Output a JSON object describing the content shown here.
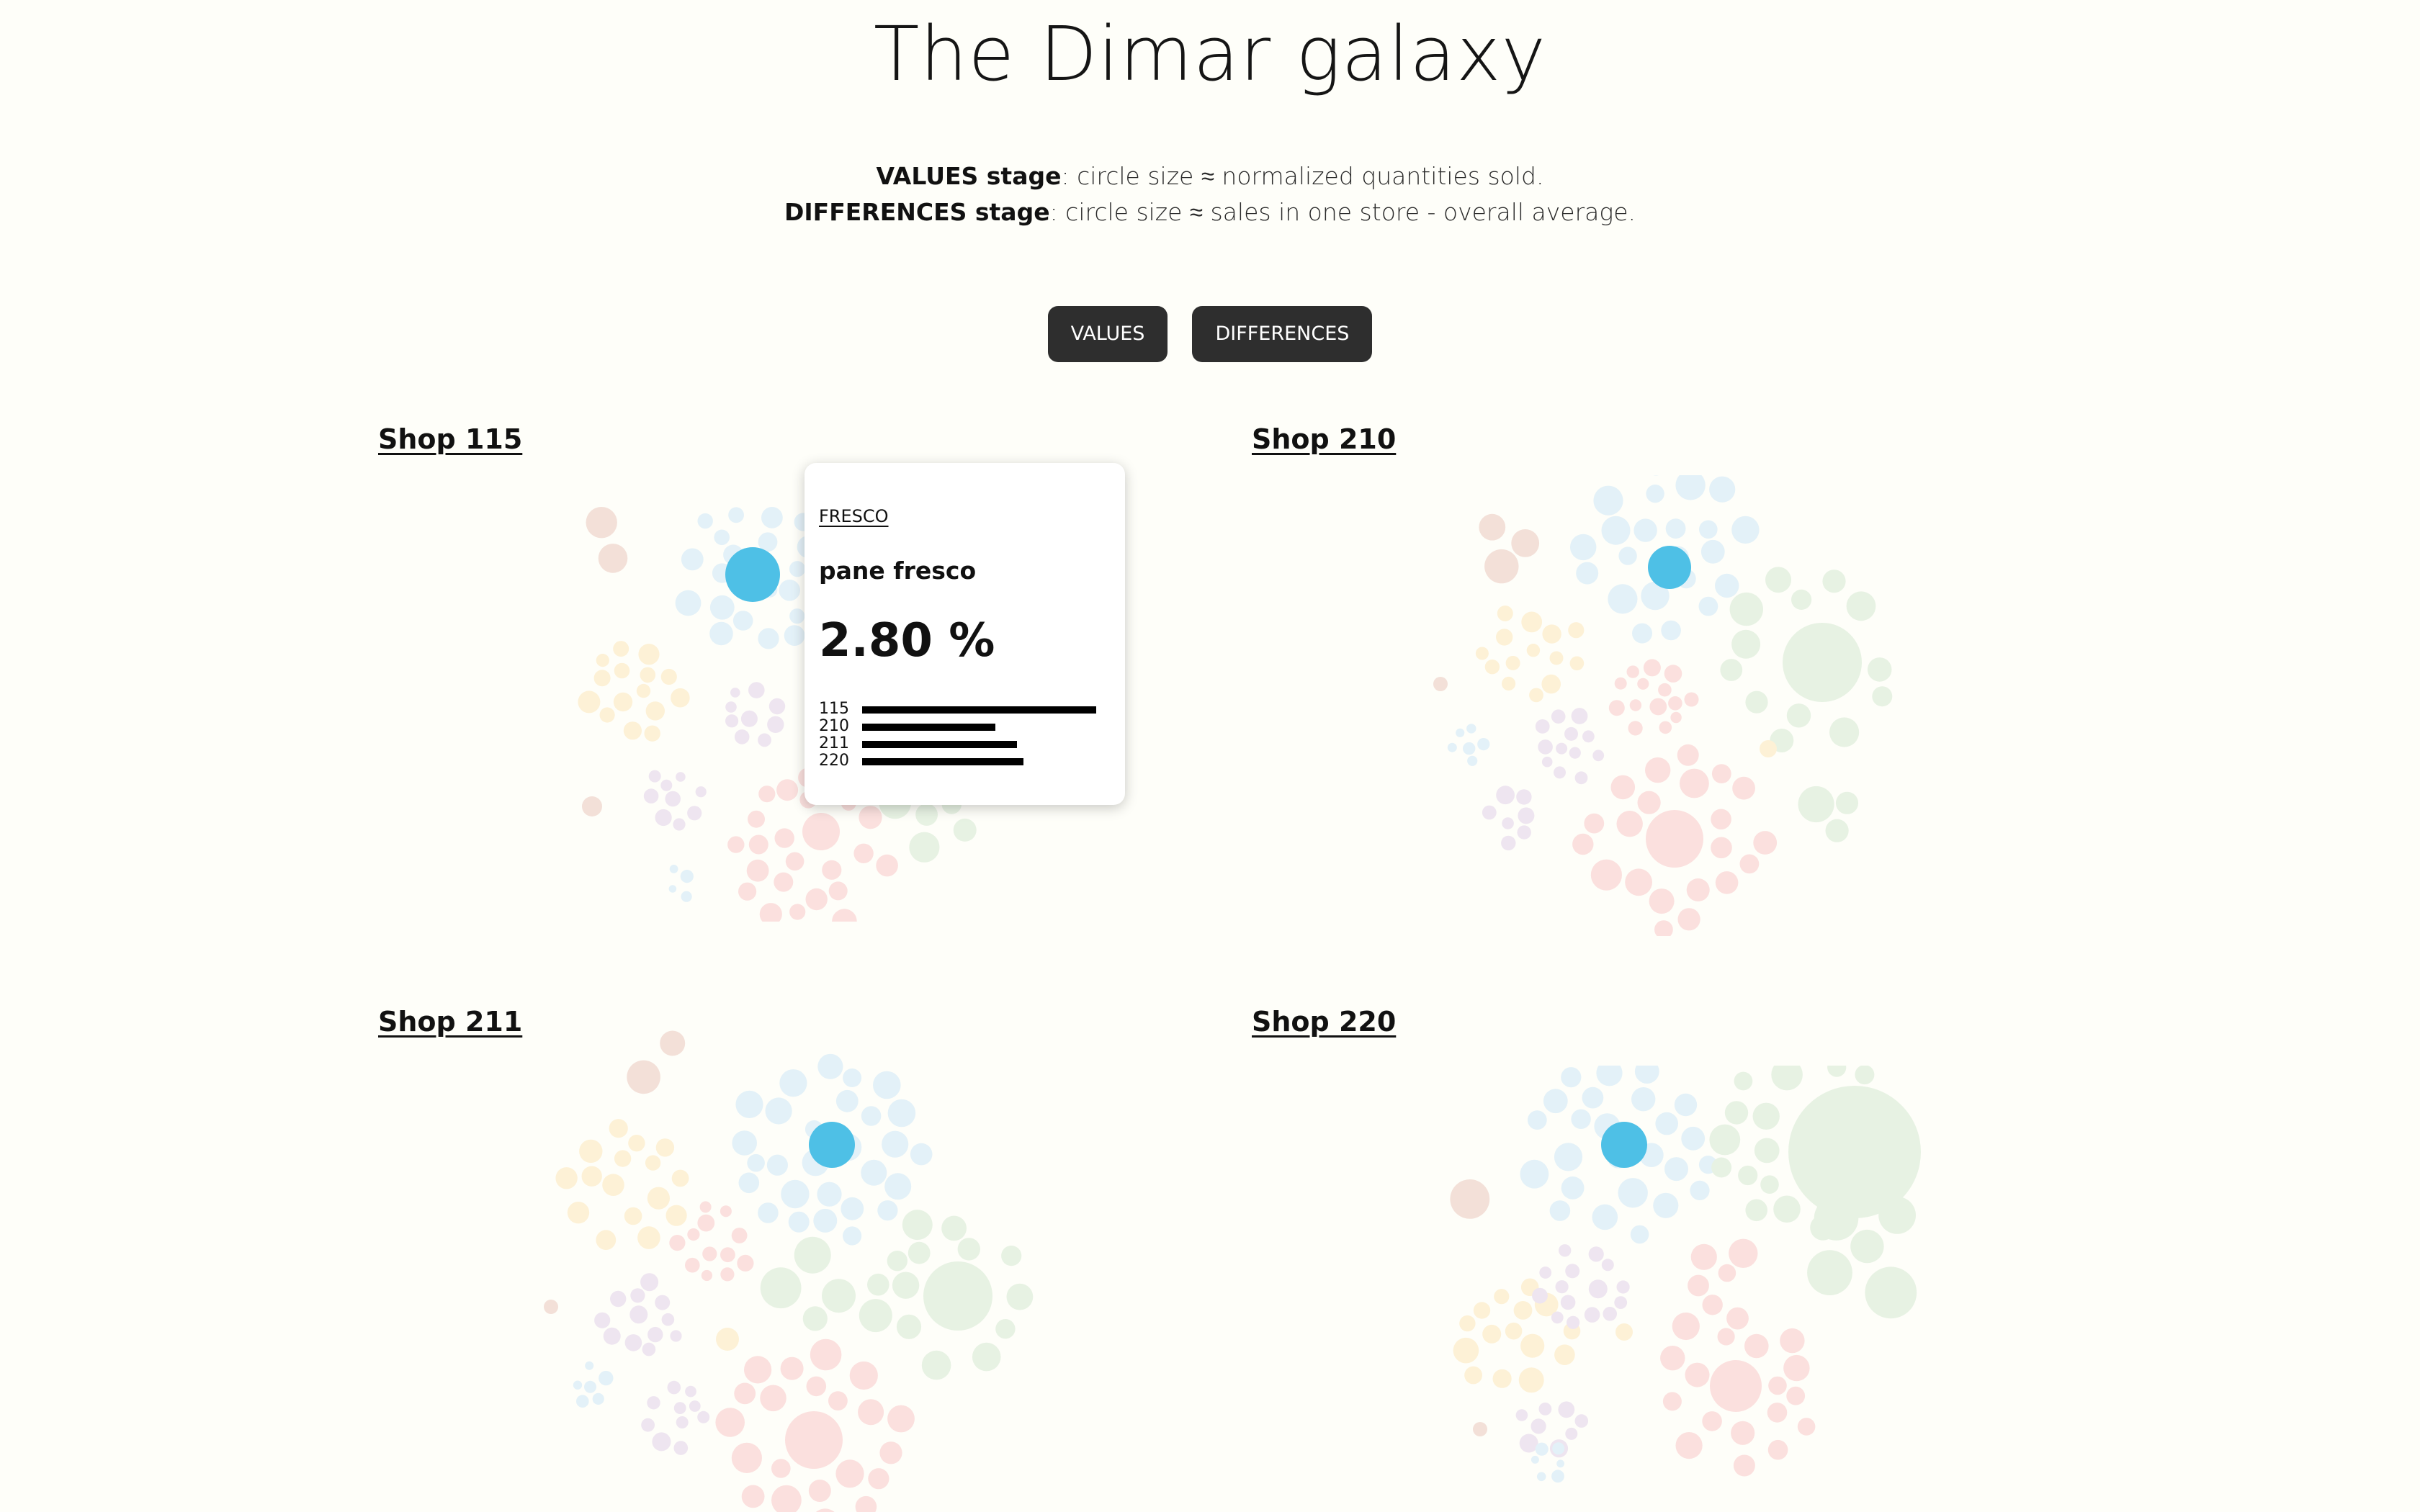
{
  "title": "The Dimar galaxy",
  "subtitle": {
    "line1_bold": "VALUES stage",
    "line1_rest": ": circle size ≈ normalized quantities sold.",
    "line2_bold": "DIFFERENCES stage",
    "line2_rest": ": circle size ≈ sales in one store - overall average."
  },
  "buttons": {
    "values": "VALUES",
    "differences": "DIFFERENCES"
  },
  "colors": {
    "highlight": "#4ec0e6",
    "fresco": "#e3f1f8",
    "red": "#fbe0de",
    "green": "#e7f2e3",
    "yellow": "#fdf1d6",
    "purple": "#eee5f0",
    "brown": "#f3e0d8"
  },
  "chart_data": [
    {
      "type": "bubble",
      "shop": "Shop 115",
      "highlighted_item": "pane fresco"
    },
    {
      "type": "bubble",
      "shop": "Shop 210",
      "highlighted_item": "pane fresco"
    },
    {
      "type": "bubble",
      "shop": "Shop 211",
      "highlighted_item": "pane fresco"
    },
    {
      "type": "bubble",
      "shop": "Shop 220",
      "highlighted_item": "pane fresco"
    }
  ],
  "tooltip": {
    "category": "FRESCO",
    "item": "pane fresco",
    "value": "2.80 %",
    "bars": [
      {
        "shop": "115",
        "value": 1.0
      },
      {
        "shop": "210",
        "value": 0.57
      },
      {
        "shop": "211",
        "value": 0.66
      },
      {
        "shop": "220",
        "value": 0.69
      }
    ]
  }
}
